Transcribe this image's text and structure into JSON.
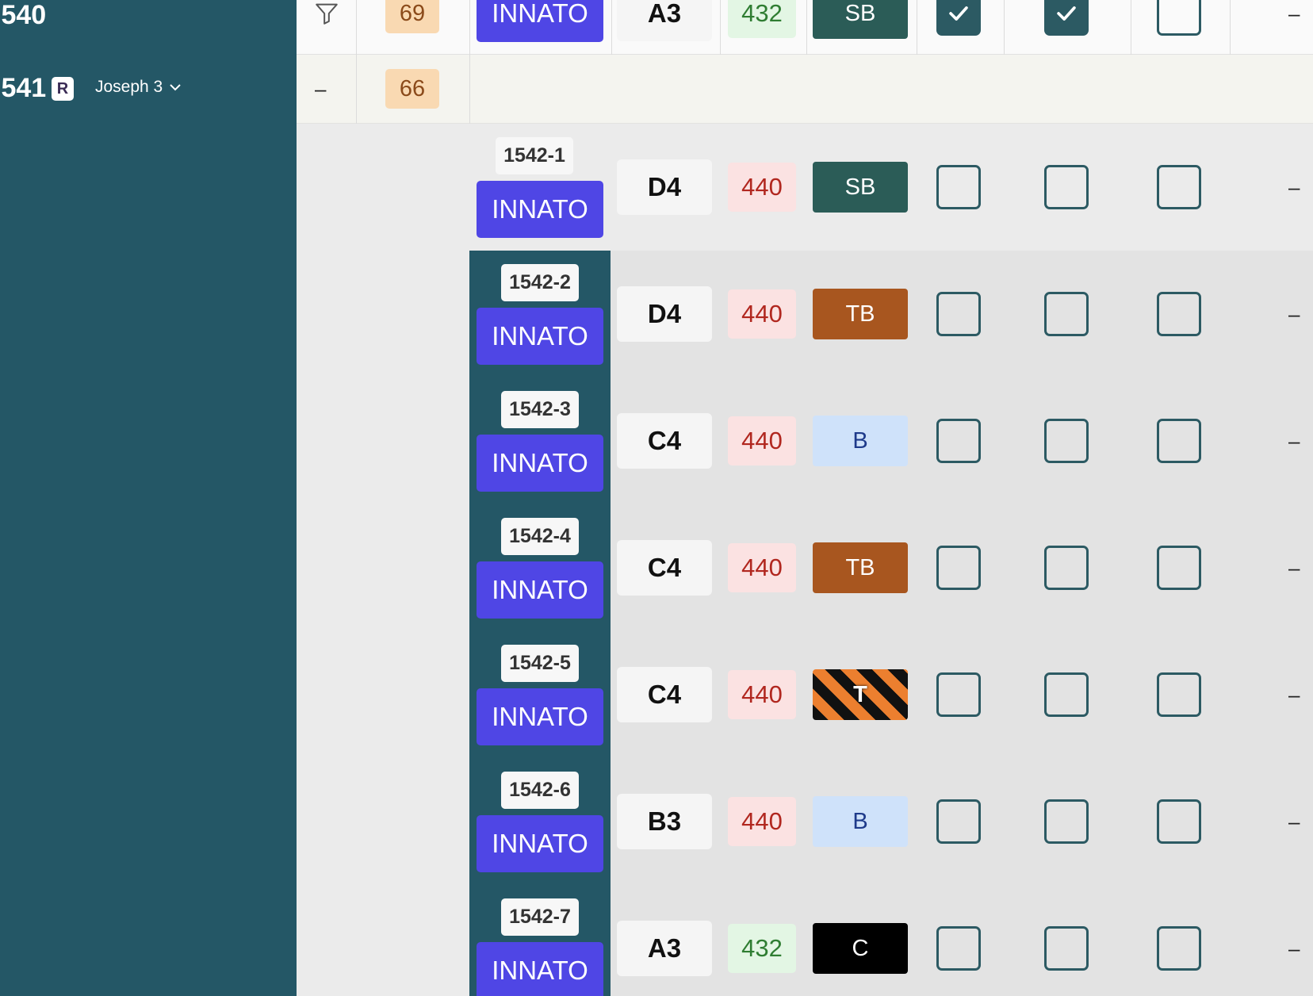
{
  "sidebar": {
    "rows": [
      {
        "number": ".540"
      },
      {
        "number": ".541",
        "badge": "R",
        "user": "Joseph 3"
      }
    ]
  },
  "top_rows": [
    {
      "marker": "filter-icon",
      "score": "69",
      "type": "INNATO",
      "code": "A3",
      "value": "432",
      "value_color": "green",
      "tag": "SB",
      "checks": [
        true,
        true,
        false
      ]
    },
    {
      "marker": "–",
      "score": "66"
    }
  ],
  "sub_rows": [
    {
      "id": "1542-1",
      "type": "INNATO",
      "code": "D4",
      "value": "440",
      "value_color": "red",
      "tag": "SB",
      "checks": [
        false,
        false,
        false
      ]
    },
    {
      "id": "1542-2",
      "type": "INNATO",
      "code": "D4",
      "value": "440",
      "value_color": "red",
      "tag": "TB",
      "checks": [
        false,
        false,
        false
      ]
    },
    {
      "id": "1542-3",
      "type": "INNATO",
      "code": "C4",
      "value": "440",
      "value_color": "red",
      "tag": "B",
      "checks": [
        false,
        false,
        false
      ]
    },
    {
      "id": "1542-4",
      "type": "INNATO",
      "code": "C4",
      "value": "440",
      "value_color": "red",
      "tag": "TB",
      "checks": [
        false,
        false,
        false
      ]
    },
    {
      "id": "1542-5",
      "type": "INNATO",
      "code": "C4",
      "value": "440",
      "value_color": "red",
      "tag": "T",
      "checks": [
        false,
        false,
        false
      ]
    },
    {
      "id": "1542-6",
      "type": "INNATO",
      "code": "B3",
      "value": "440",
      "value_color": "red",
      "tag": "B",
      "checks": [
        false,
        false,
        false
      ]
    },
    {
      "id": "1542-7",
      "type": "INNATO",
      "code": "A3",
      "value": "432",
      "value_color": "green",
      "tag": "C",
      "checks": [
        false,
        false,
        false
      ]
    }
  ],
  "row_end_marker": "–",
  "colors": {
    "sidebar": "#245766",
    "innato": "#4f46e5",
    "tag_SB": "#2b5c57",
    "tag_TB": "#a8561f",
    "tag_B": "#cfe2fa",
    "tag_C": "#000000",
    "tag_T_stripes": "#ec7f2f",
    "checkbox": "#2c5a63"
  }
}
